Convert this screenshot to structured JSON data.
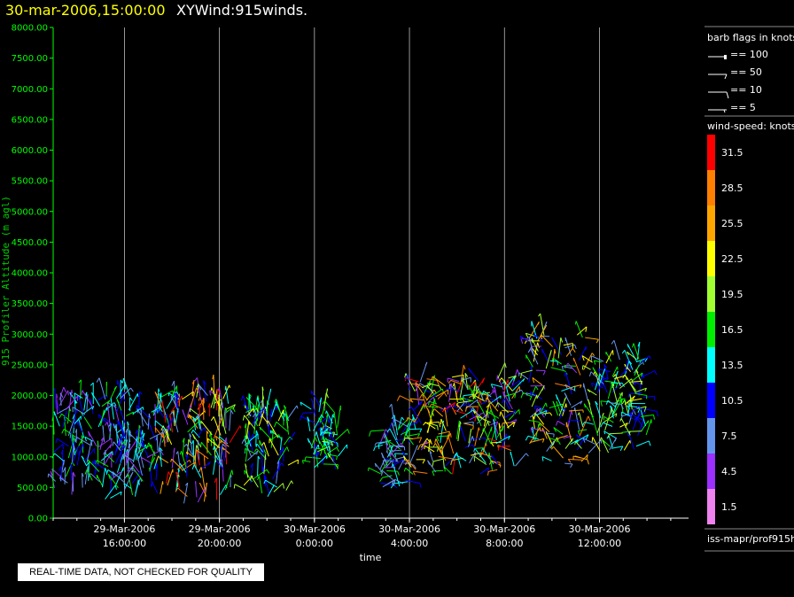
{
  "header": {
    "date": "30-mar-2006,15:00:00",
    "title": "XYWind:915winds."
  },
  "note": "REAL-TIME DATA, NOT CHECKED FOR QUALITY",
  "colors": {
    "background": "#000000",
    "axis": "#00ff00",
    "grid": "#bbbbbb",
    "header_date": "#ffff00"
  },
  "legend": {
    "barb_title": "barb flags in knots",
    "barbs": [
      "== 100",
      "== 50",
      "== 10",
      "== 5"
    ],
    "speed_title": "wind-speed: knots",
    "speed_bins": [
      {
        "label": "31.5",
        "color": "#ff0000"
      },
      {
        "label": "28.5",
        "color": "#ff7f00"
      },
      {
        "label": "25.5",
        "color": "#ffa500"
      },
      {
        "label": "22.5",
        "color": "#ffff00"
      },
      {
        "label": "19.5",
        "color": "#a0ff30"
      },
      {
        "label": "16.5",
        "color": "#00ee00"
      },
      {
        "label": "13.5",
        "color": "#00ffff"
      },
      {
        "label": "10.5",
        "color": "#0000ff"
      },
      {
        "label": "7.5",
        "color": "#6495ed"
      },
      {
        "label": "4.5",
        "color": "#9b30ff"
      },
      {
        "label": "1.5",
        "color": "#ee82ee"
      }
    ],
    "source": "iss-mapr/prof915h"
  },
  "chart_data": {
    "type": "scatter",
    "title": "XYWind:915winds.",
    "xlabel": "time",
    "ylabel": "915 Profiler Altitude (m agl)",
    "ylim": [
      0,
      8000
    ],
    "y_ticks": [
      "0.00",
      "500.00",
      "1000.00",
      "1500.00",
      "2000.00",
      "2500.00",
      "3000.00",
      "3500.00",
      "4000.00",
      "4500.00",
      "5000.00",
      "5500.00",
      "6000.00",
      "6500.00",
      "7000.00",
      "7500.00",
      "8000.00"
    ],
    "xlim": [
      "29-Mar-2006 13:00",
      "30-Mar-2006 15:45"
    ],
    "x_ticks": [
      {
        "date": "29-Mar-2006",
        "time": "16:00:00"
      },
      {
        "date": "29-Mar-2006",
        "time": "20:00:00"
      },
      {
        "date": "30-Mar-2006",
        "time": "0:00:00"
      },
      {
        "date": "30-Mar-2006",
        "time": "4:00:00"
      },
      {
        "date": "30-Mar-2006",
        "time": "8:00:00"
      },
      {
        "date": "30-Mar-2006",
        "time": "12:00:00"
      }
    ],
    "grid": "vertical lines at labeled times",
    "wind_clusters": [
      {
        "start": "29-Mar-2006 13:00",
        "end": "29-Mar-2006 17:30",
        "alt_min": 300,
        "alt_max": 2000,
        "speed_knots": "4.5-16.5"
      },
      {
        "start": "29-Mar-2006 17:30",
        "end": "29-Mar-2006 20:30",
        "alt_min": 200,
        "alt_max": 2000,
        "speed_knots": "4.5-31.5"
      },
      {
        "start": "29-Mar-2006 21:00",
        "end": "29-Mar-2006 23:00",
        "alt_min": 300,
        "alt_max": 1800,
        "speed_knots": "7.5-22.5"
      },
      {
        "start": "29-Mar-2006 23:45",
        "end": "30-Mar-2006 01:00",
        "alt_min": 700,
        "alt_max": 1800,
        "speed_knots": "10.5-19.5"
      },
      {
        "start": "30-Mar-2006 02:45",
        "end": "30-Mar-2006 04:00",
        "alt_min": 500,
        "alt_max": 1500,
        "speed_knots": "4.5-16.5"
      },
      {
        "start": "30-Mar-2006 04:00",
        "end": "30-Mar-2006 08:30",
        "alt_min": 700,
        "alt_max": 2300,
        "speed_knots": "4.5-31.5"
      },
      {
        "start": "30-Mar-2006 09:00",
        "end": "30-Mar-2006 11:30",
        "alt_min": 800,
        "alt_max": 3000,
        "speed_knots": "4.5-28.5"
      },
      {
        "start": "30-Mar-2006 11:30",
        "end": "30-Mar-2006 14:00",
        "alt_min": 1000,
        "alt_max": 2600,
        "speed_knots": "7.5-22.5"
      }
    ]
  }
}
